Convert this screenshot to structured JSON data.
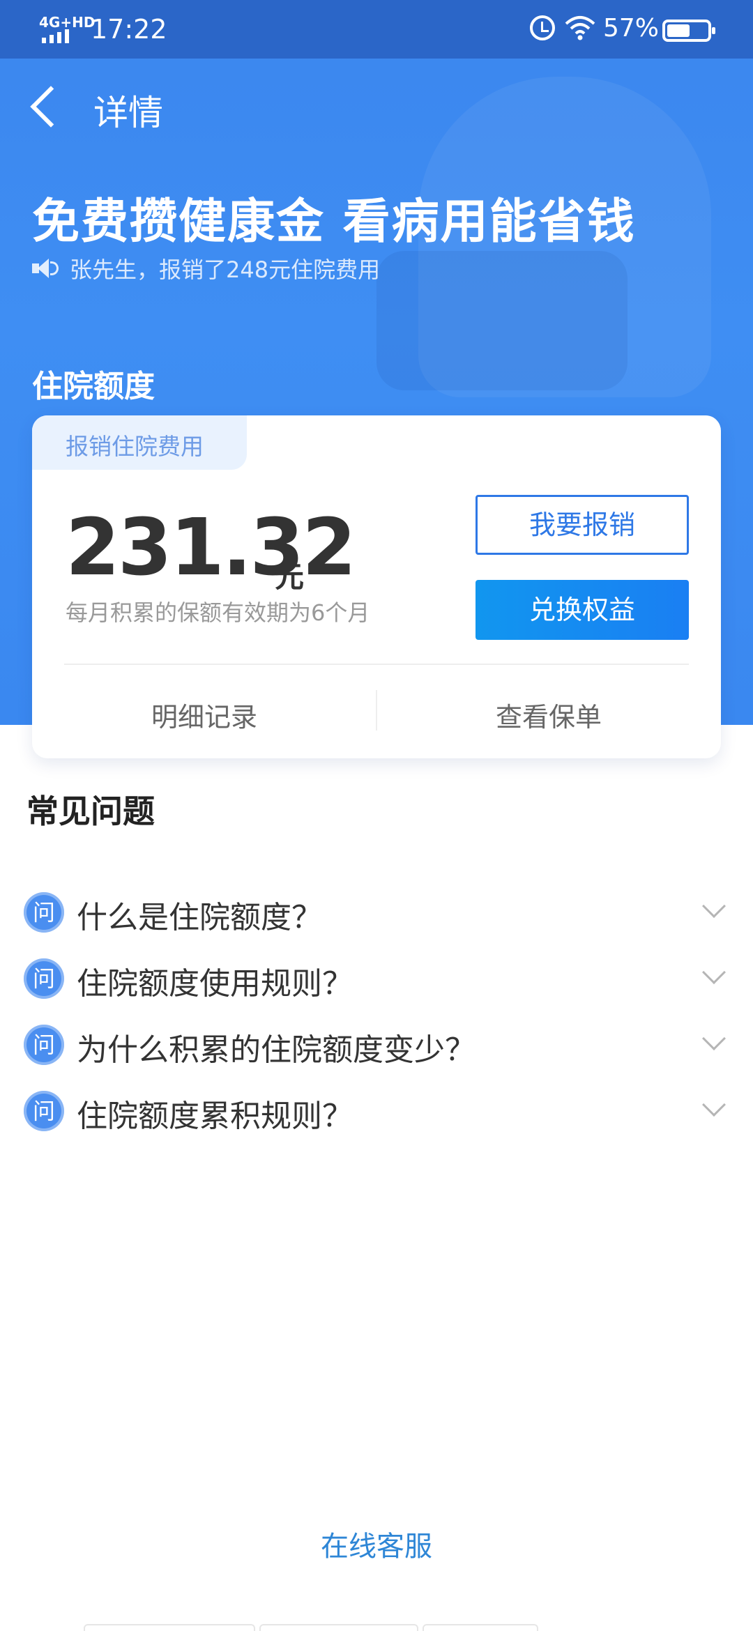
{
  "status_bar": {
    "network": "4G+HD",
    "time": "17:22",
    "battery_percent": "57%",
    "battery_level": 0.57
  },
  "nav": {
    "title": "详情"
  },
  "hero": {
    "title": "免费攒健康金 看病用能省钱",
    "notice": "张先生，报销了248元住院费用"
  },
  "quota": {
    "section_title": "住院额度",
    "tag": "报销住院费用",
    "amount": "231.32",
    "unit": "元",
    "note": "每月积累的保额有效期为6个月",
    "claim_button": "我要报销",
    "redeem_button": "兑换权益",
    "links": [
      "明细记录",
      "查看保单"
    ]
  },
  "faq": {
    "title": "常见问题",
    "q_badge": "问",
    "items": [
      "什么是住院额度？",
      "住院额度使用规则？",
      "为什么积累的住院额度变少？",
      "住院额度累积规则？"
    ]
  },
  "footer": {
    "service_link": "在线客服"
  },
  "colors": {
    "hero_blue": "#3b86ee",
    "accent_blue": "#2e78e6",
    "link_blue": "#2e86d6"
  }
}
